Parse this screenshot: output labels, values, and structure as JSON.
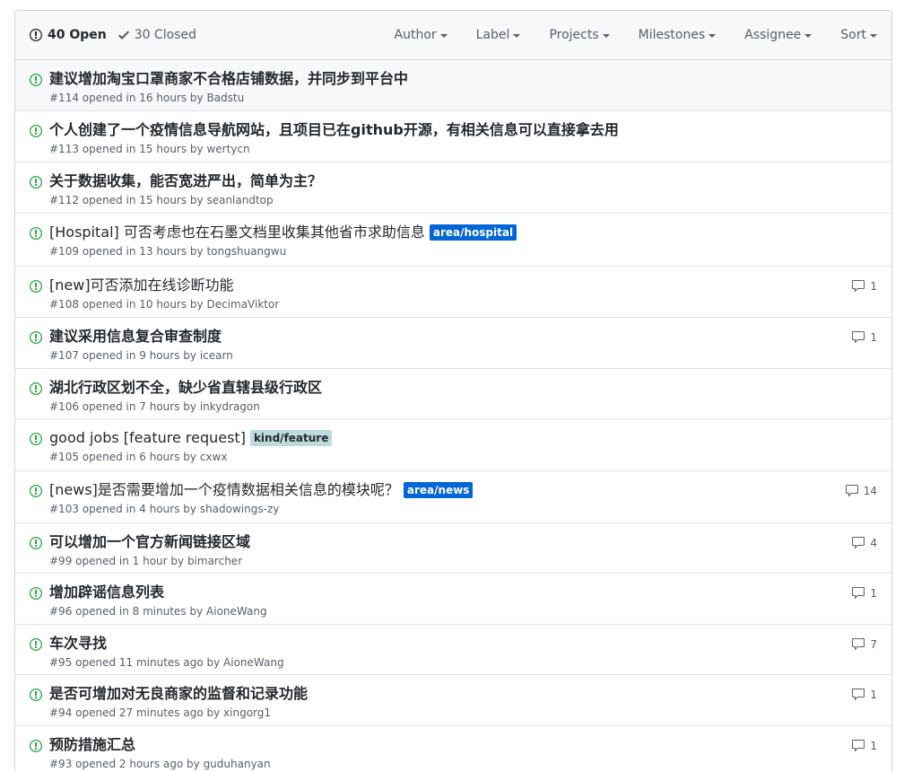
{
  "header": {
    "open_count": "40 Open",
    "closed_count": "30 Closed",
    "filters": [
      "Author",
      "Label",
      "Projects",
      "Milestones",
      "Assignee",
      "Sort"
    ]
  },
  "colors": {
    "open_icon": "#28a745",
    "label_blue": "#0366d6",
    "label_light": "#bfdadc"
  },
  "issues": [
    {
      "title": "建议增加淘宝口罩商家不合格店铺数据，并同步到平台中",
      "meta": "#114 opened in 16 hours by Badstu",
      "comments": "",
      "label": ""
    },
    {
      "title": "个人创建了一个疫情信息导航网站，且项目已在github开源，有相关信息可以直接拿去用",
      "meta": "#113 opened in 15 hours by wertycn",
      "comments": "",
      "label": ""
    },
    {
      "title": "关于数据收集，能否宽进严出，简单为主？",
      "meta": "#112 opened in 15 hours by seanlandtop",
      "comments": "",
      "label": ""
    },
    {
      "title": "[Hospital] 可否考虑也在石墨文档里收集其他省市求助信息",
      "meta": "#109 opened in 13 hours by tongshuangwu",
      "comments": "",
      "label": "area/hospital"
    },
    {
      "title": "[new]可否添加在线诊断功能",
      "meta": "#108 opened in 10 hours by DecimaViktor",
      "comments": "1",
      "label": ""
    },
    {
      "title": "建议采用信息复合审查制度",
      "meta": "#107 opened in 9 hours by icearn",
      "comments": "1",
      "label": ""
    },
    {
      "title": "湖北行政区划不全，缺少省直辖县级行政区",
      "meta": "#106 opened in 7 hours by inkydragon",
      "comments": "",
      "label": ""
    },
    {
      "title": "good jobs [feature request]",
      "meta": "#105 opened in 6 hours by cxwx",
      "comments": "",
      "label": "kind/feature"
    },
    {
      "title": "[news]是否需要增加一个疫情数据相关信息的模块呢？",
      "meta": "#103 opened in 4 hours by shadowings-zy",
      "comments": "14",
      "label": "area/news"
    },
    {
      "title": "可以增加一个官方新闻链接区域",
      "meta": "#99 opened in 1 hour by bimarcher",
      "comments": "4",
      "label": ""
    },
    {
      "title": "增加辟谣信息列表",
      "meta": "#96 opened in 8 minutes by AioneWang",
      "comments": "1",
      "label": ""
    },
    {
      "title": "车次寻找",
      "meta": "#95 opened 11 minutes ago by AioneWang",
      "comments": "7",
      "label": ""
    },
    {
      "title": "是否可增加对无良商家的监督和记录功能",
      "meta": "#94 opened 27 minutes ago by xingorg1",
      "comments": "1",
      "label": ""
    },
    {
      "title": "预防措施汇总",
      "meta": "#93 opened 2 hours ago by guduhanyan",
      "comments": "1",
      "label": ""
    }
  ]
}
